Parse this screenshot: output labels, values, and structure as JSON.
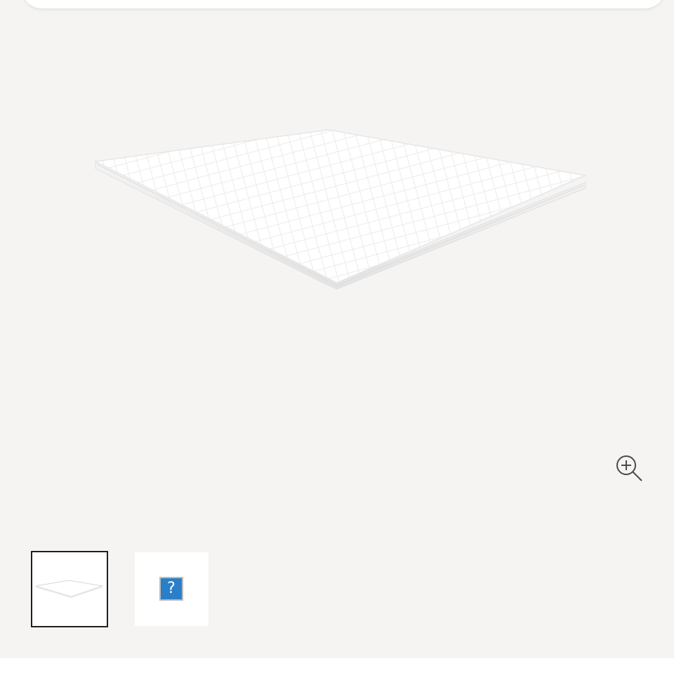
{
  "gallery": {
    "background_color": "#f5f4f2",
    "main_image": {
      "icon": "mattress-topper-image"
    },
    "zoom_button": {
      "icon": "zoom-in-icon"
    },
    "thumbnails": [
      {
        "icon": "mattress-topper-thumbnail",
        "selected": true
      },
      {
        "icon": "broken-image-icon",
        "glyph": "?",
        "selected": false
      }
    ]
  }
}
